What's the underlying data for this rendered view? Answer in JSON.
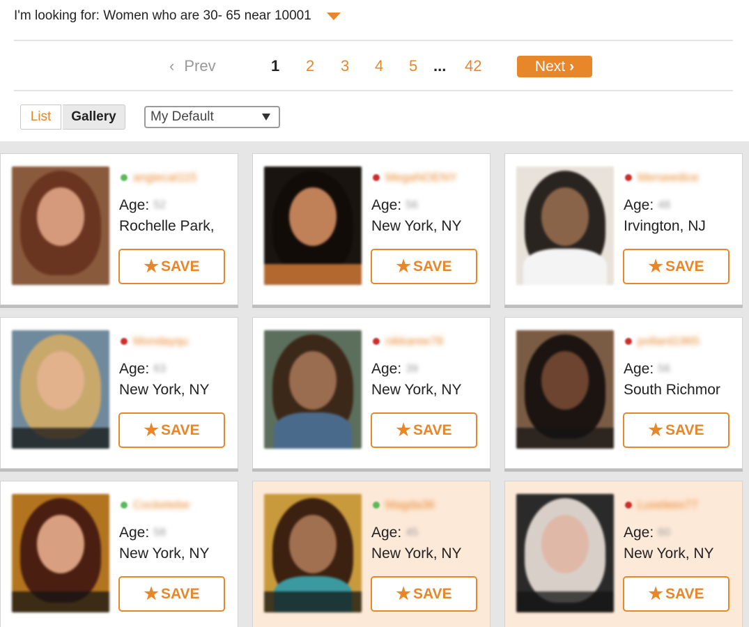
{
  "search": {
    "looking_for": "I'm looking for: Women who are 30- 65 near 10001"
  },
  "pagination": {
    "prev_label": "Prev",
    "pages": [
      "1",
      "2",
      "3",
      "4",
      "5"
    ],
    "current_page": "1",
    "ellipsis": "...",
    "last_page": "42",
    "next_label": "Next"
  },
  "view": {
    "list_label": "List",
    "gallery_label": "Gallery",
    "sort_selected": "My Default"
  },
  "colors": {
    "accent": "#e8862a",
    "online": "#5cb85c",
    "offline": "#c9302c",
    "highlight_card": "#fde9d8"
  },
  "profiles": [
    {
      "username": "angiecat115",
      "status": "online",
      "age_label": "Age:",
      "age": "52",
      "location": "Rochelle Park,",
      "save_label": "SAVE",
      "highlighted": false
    },
    {
      "username": "MegaNOENY",
      "status": "offline",
      "age_label": "Age:",
      "age": "56",
      "location": "New York, NY",
      "save_label": "SAVE",
      "highlighted": false
    },
    {
      "username": "Merseedice",
      "status": "offline",
      "age_label": "Age:",
      "age": "48",
      "location": "Irvington, NJ",
      "save_label": "SAVE",
      "highlighted": false
    },
    {
      "username": "Mondayqu",
      "status": "offline",
      "age_label": "Age:",
      "age": "63",
      "location": "New York, NY",
      "save_label": "SAVE",
      "highlighted": false
    },
    {
      "username": "nikkaree78",
      "status": "offline",
      "age_label": "Age:",
      "age": "39",
      "location": "New York, NY",
      "save_label": "SAVE",
      "highlighted": false
    },
    {
      "username": "pollard1965",
      "status": "offline",
      "age_label": "Age:",
      "age": "56",
      "location": "South Richmor",
      "save_label": "SAVE",
      "highlighted": false
    },
    {
      "username": "Cocketebe",
      "status": "online",
      "age_label": "Age:",
      "age": "58",
      "location": "New York, NY",
      "save_label": "SAVE",
      "highlighted": false
    },
    {
      "username": "Magda36",
      "status": "online",
      "age_label": "Age:",
      "age": "45",
      "location": "New York, NY",
      "save_label": "SAVE",
      "highlighted": true
    },
    {
      "username": "Luxeleex77",
      "status": "offline",
      "age_label": "Age:",
      "age": "60",
      "location": "New York, NY",
      "save_label": "SAVE",
      "highlighted": true
    }
  ]
}
